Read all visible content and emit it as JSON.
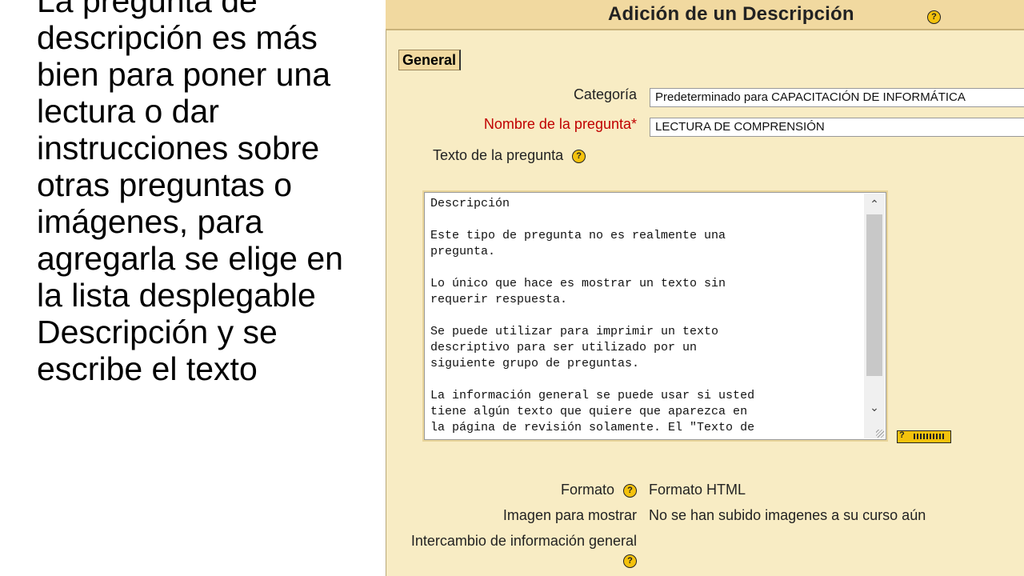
{
  "narration": {
    "text": "La pregunta de descripción es más bien para poner una lectura o dar instrucciones sobre otras preguntas o imágenes, para agregarla se elige en la lista desplegable Descripción y se escribe el texto"
  },
  "form": {
    "title": "Adición de un Descripción",
    "help_glyph": "?",
    "section_legend": "General",
    "category": {
      "label": "Categoría",
      "value": "Predeterminado para CAPACITACIÓN DE INFORMÁTICA"
    },
    "question_name": {
      "label": "Nombre de la pregunta*",
      "value": "LECTURA DE COMPRENSIÓN"
    },
    "question_text": {
      "label": "Texto de la pregunta",
      "content": "Descripción\n\nEste tipo de pregunta no es realmente una\npregunta.\n\nLo único que hace es mostrar un texto sin\nrequerir respuesta.\n\nSe puede utilizar para imprimir un texto\ndescriptivo para ser utilizado por un\nsiguiente grupo de preguntas.\n\nLa información general se puede usar si usted\ntiene algún texto que quiere que aparezca en\nla página de revisión solamente. El \"Texto de"
    },
    "format": {
      "label": "Formato",
      "value": "Formato HTML"
    },
    "image": {
      "label": "Imagen para mostrar",
      "value": "No se han subido imagenes a su curso aún"
    },
    "general_feedback": {
      "label": "Intercambio de información general"
    }
  },
  "colors": {
    "panel_bg": "#f8ecc4",
    "title_bar": "#f1d9a0",
    "required_label": "#c00000",
    "help_icon": "#f4c20d"
  },
  "icons": {
    "help": "help-icon",
    "scroll_up": "chevron-up-icon",
    "scroll_down": "chevron-down-icon"
  }
}
